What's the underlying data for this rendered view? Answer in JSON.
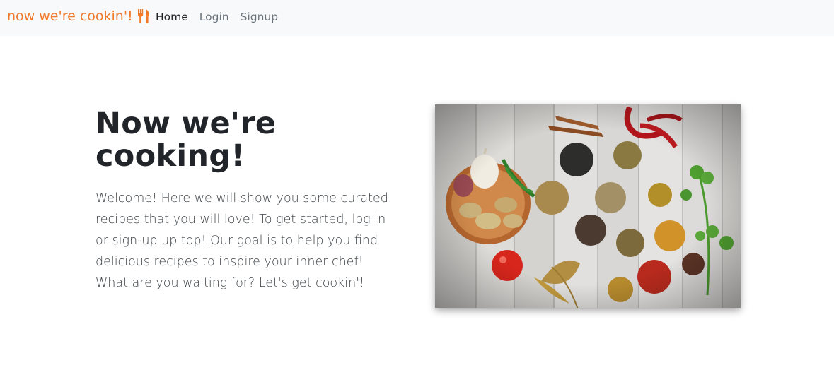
{
  "navbar": {
    "brand": "now we're cookin'!",
    "brand_icon": "utensils-icon",
    "links": [
      {
        "label": "Home",
        "active": true
      },
      {
        "label": "Login",
        "active": false
      },
      {
        "label": "Signup",
        "active": false
      }
    ]
  },
  "hero": {
    "title": "Now we're cooking!",
    "text": "Welcome! Here we will show you some curated recipes that you will love! To get started, log in or sign-up up top! Our goal is to help you find delicious recipes to inspire your inner chef! What are you waiting for? Let's get cookin'!",
    "image_description_icon": "spices-photo"
  },
  "colors": {
    "brand": "#ef7a2c",
    "navbar_bg": "#f8f9fa",
    "text_dark": "#212529",
    "nav_muted": "#6c757d"
  }
}
